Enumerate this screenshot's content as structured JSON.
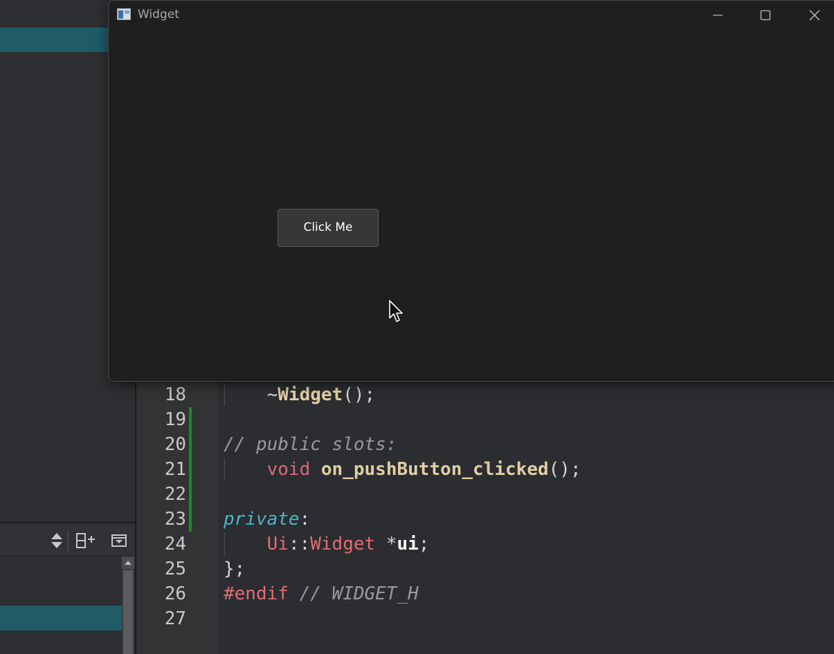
{
  "window": {
    "title": "Widget",
    "button_label": "Click Me"
  },
  "editor": {
    "lines": [
      {
        "num": "18",
        "parts": [
          {
            "t": "    ",
            "c": "t-punct"
          },
          {
            "t": "~",
            "c": "t-punct"
          },
          {
            "t": "Widget",
            "c": "t-fn"
          },
          {
            "t": "();",
            "c": "t-punct"
          }
        ]
      },
      {
        "num": "19",
        "parts": []
      },
      {
        "num": "20",
        "parts": [
          {
            "t": "// public slots:",
            "c": "t-cm"
          }
        ]
      },
      {
        "num": "21",
        "parts": [
          {
            "t": "    ",
            "c": "t-punct"
          },
          {
            "t": "void",
            "c": "t-kw"
          },
          {
            "t": " ",
            "c": "t-punct"
          },
          {
            "t": "on_pushButton_clicked",
            "c": "t-fn"
          },
          {
            "t": "();",
            "c": "t-punct"
          }
        ]
      },
      {
        "num": "22",
        "parts": []
      },
      {
        "num": "23",
        "parts": [
          {
            "t": "private",
            "c": "t-priv"
          },
          {
            "t": ":",
            "c": "t-punct"
          }
        ]
      },
      {
        "num": "24",
        "parts": [
          {
            "t": "    ",
            "c": "t-punct"
          },
          {
            "t": "Ui",
            "c": "t-ty"
          },
          {
            "t": "::",
            "c": "t-punct"
          },
          {
            "t": "Widget",
            "c": "t-ty"
          },
          {
            "t": " *",
            "c": "t-punct"
          },
          {
            "t": "ui",
            "c": "t-id"
          },
          {
            "t": ";",
            "c": "t-punct"
          }
        ]
      },
      {
        "num": "25",
        "parts": [
          {
            "t": "};",
            "c": "t-punct"
          }
        ]
      },
      {
        "num": "26",
        "parts": [
          {
            "t": "#endif",
            "c": "t-pp"
          },
          {
            "t": " ",
            "c": "t-punct"
          },
          {
            "t": "// WIDGET_H",
            "c": "t-cm"
          }
        ]
      },
      {
        "num": "27",
        "parts": []
      }
    ]
  },
  "icons": {
    "app": "qt-app-icon",
    "minimize": "minimize-icon",
    "maximize": "maximize-icon",
    "close": "close-icon",
    "sort": "sort-updown-icon",
    "split": "split-add-icon",
    "collapse": "panel-collapse-icon"
  },
  "colors": {
    "selection": "#1f5c67",
    "change_bar": "#1f8a1f",
    "window_bg": "#1f1f1f",
    "editor_bg": "#2b2d30"
  }
}
